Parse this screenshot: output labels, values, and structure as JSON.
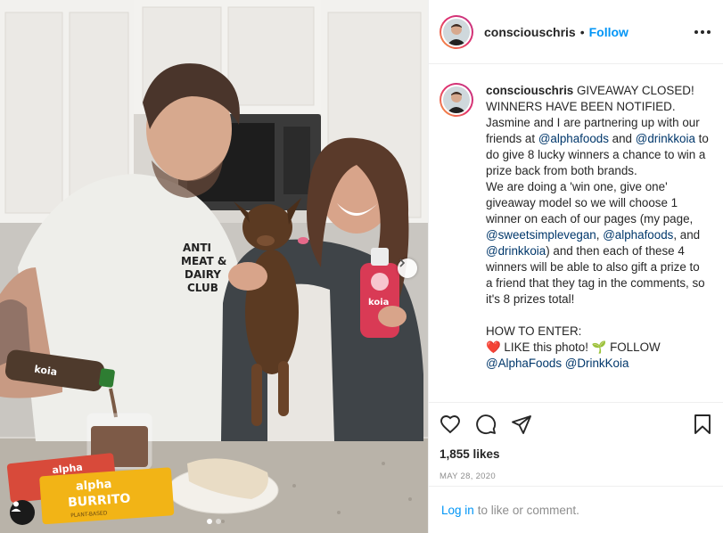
{
  "post": {
    "username": "consciouschris",
    "follow_label": "Follow",
    "separator": "•",
    "caption": {
      "username": "consciouschris",
      "p1": " GIVEAWAY CLOSED! WINNERS HAVE BEEN NOTIFIED.",
      "p2a": "Jasmine and I are partnering up with our friends at ",
      "m_alphafoods": "@alphafoods",
      "p2b": " and ",
      "m_drinkkoia": "@drinkkoia",
      "p2c": " to do give 8 lucky winners a chance to win a prize back from both brands.",
      "p3a": "We are doing a 'win one, give one' giveaway model so we will choose 1 winner on each of our pages (my page, ",
      "m_sweetsimplevegan": "@sweetsimplevegan",
      "p3b": ", ",
      "m_alphafoods2": "@alphafoods",
      "p3c": ", and ",
      "m_drinkkoia2": "@drinkkoia",
      "p3d": ") and then each of these 4 winners will be able to also gift a prize to a friend that they tag in the comments, so it's 8 prizes total!",
      "how_to": "HOW TO ENTER:",
      "heart": "❤️",
      "step1": " LIKE this photo! ",
      "sprout": "🌱",
      "step2": " FOLLOW",
      "cut_line": "@AlphaFoods @DrinkKoia"
    },
    "likes": "1,855 likes",
    "date": "MAY 28, 2020",
    "login_link": "Log in",
    "login_rest": "to like or comment."
  },
  "photo": {
    "bottle_label": "koia",
    "shirt_text": [
      "ANTI",
      "MEAT &",
      "DAIRY",
      "CLUB"
    ],
    "wrapper_brand": "alpha",
    "wrapper_product": "BURRITO",
    "wrapper_small": "PLANT-BASED",
    "carousel_count": 2,
    "carousel_active": 1
  },
  "colors": {
    "accent_blue": "#0095f6",
    "mention_blue": "#00376b",
    "text": "#262626",
    "muted": "#8e8e8e",
    "border": "#efefef"
  },
  "icons": [
    "more-options-icon",
    "heart-icon",
    "comment-icon",
    "share-icon",
    "bookmark-icon",
    "next-arrow-icon",
    "user-tag-icon"
  ]
}
